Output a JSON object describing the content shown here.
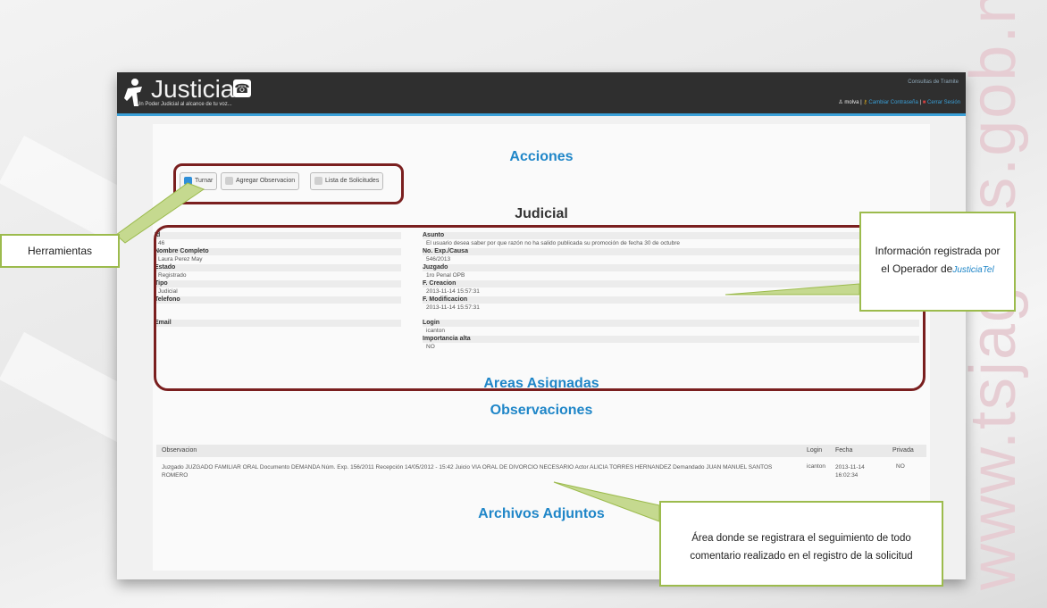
{
  "watermark": "www.tsjaguas.gob.mx",
  "app": {
    "logo_text": "Justicia-",
    "logo_phone_glyph": "☎",
    "tagline": "Un Poder Judicial al alcance de tu voz...",
    "top_right_link": "Consultas de Tramite",
    "user": "molva",
    "user_link_1": "Cambiar Contraseña",
    "user_link_2": "Cerrar Sesión"
  },
  "sections": {
    "acciones": "Acciones",
    "judicial": "Judicial",
    "areas": "Areas Asignadas",
    "observaciones": "Observaciones",
    "archivos": "Archivos Adjuntos"
  },
  "buttons": {
    "turnar": "Turnar",
    "agregar": "Agregar Observacion",
    "lista": "Lista de Solicitudes"
  },
  "fields_left": [
    {
      "label": "Id",
      "value": "46"
    },
    {
      "label": "Nombre Completo",
      "value": "Laura Perez May"
    },
    {
      "label": "Estado",
      "value": "Registrado"
    },
    {
      "label": "Tipo",
      "value": "Judicial"
    },
    {
      "label": "Telefono",
      "value": ""
    },
    {
      "label": "Email",
      "value": ""
    }
  ],
  "fields_right": [
    {
      "label": "Asunto",
      "value": "El usuario desea saber por que razón no ha salido publicada su promoción de fecha 30 de octubre"
    },
    {
      "label": "No. Exp./Causa",
      "value": "546/2013"
    },
    {
      "label": "Juzgado",
      "value": "1ro Penal OPB"
    },
    {
      "label": "F. Creacion",
      "value": "2013-11-14 15:57:31"
    },
    {
      "label": "F. Modificacion",
      "value": "2013-11-14 15:57:31"
    },
    {
      "label": "Login",
      "value": "icanton"
    },
    {
      "label": "Importancia alta",
      "value": "NO"
    }
  ],
  "obs_table": {
    "headers": {
      "observacion": "Observacion",
      "login": "Login",
      "fecha": "Fecha",
      "privada": "Privada"
    },
    "row": {
      "observacion": "Juzgado JUZGADO FAMILIAR ORAL Documento DEMANDA Núm. Exp. 156/2011 Recepción 14/05/2012 - 15:42 Juicio VIA ORAL DE DIVORCIO NECESARIO Actor ALICIA TORRES HERNANDEZ Demandado JUAN MANUEL SANTOS ROMERO",
      "login": "icanton",
      "fecha": "2013-11-14 16:02:34",
      "privada": "NO"
    }
  },
  "annotations": {
    "herramientas": "Herramientas",
    "info_1": "Información registrada por",
    "info_2": "el Operador de",
    "info_brand": "JusticiaTel",
    "area_1": "Área donde se registrara el seguimiento de todo",
    "area_2": "comentario realizado en el registro de la solicitud"
  },
  "colors": {
    "accent": "#1f86c8",
    "highlight_border": "#7a1f1f",
    "note_border": "#9cbb4d"
  }
}
